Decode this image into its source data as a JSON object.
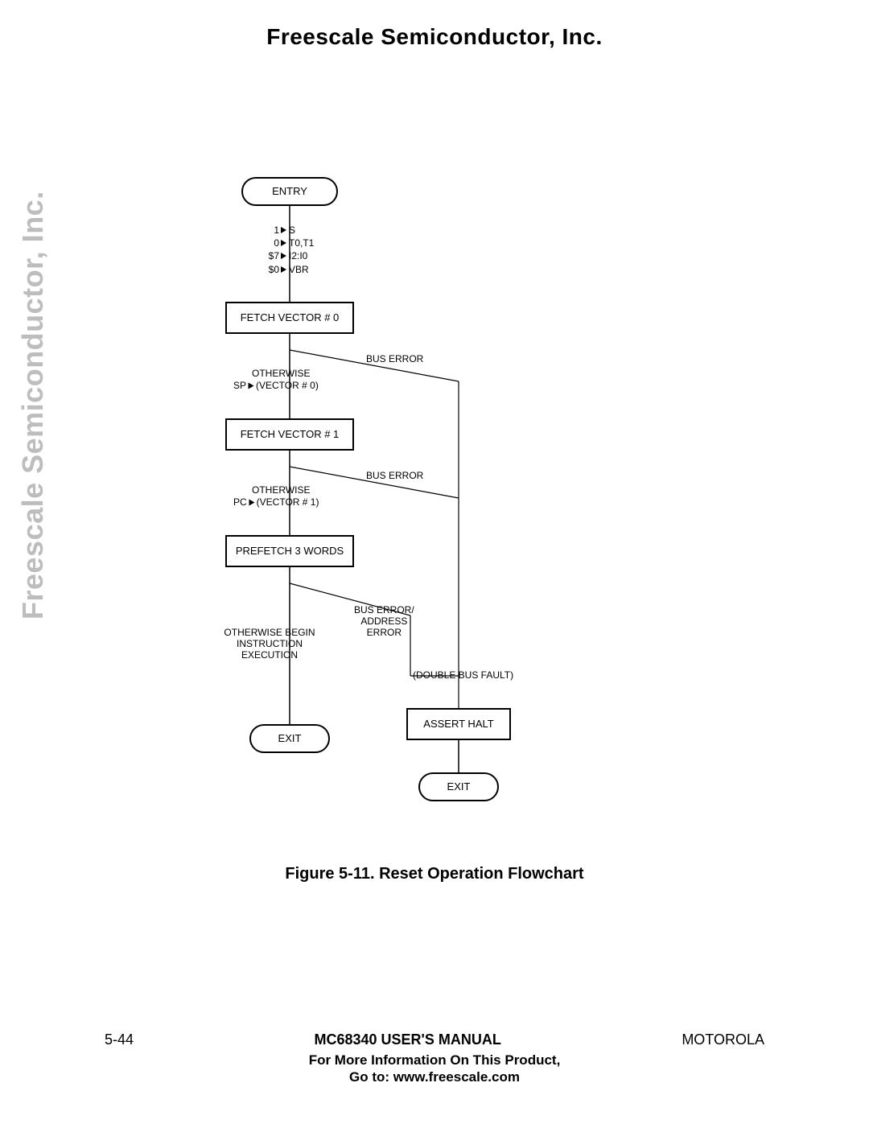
{
  "header": {
    "title": "Freescale Semiconductor, Inc."
  },
  "watermark": {
    "text": "Freescale Semiconductor, Inc."
  },
  "flow": {
    "entry": "ENTRY",
    "init": [
      {
        "l": "1",
        "r": "S"
      },
      {
        "l": "0",
        "r": "T0,T1"
      },
      {
        "l": "$7",
        "r": "I2:I0"
      },
      {
        "l": "$0",
        "r": "VBR"
      }
    ],
    "fetch0": "FETCH VECTOR # 0",
    "fetch1": "FETCH VECTOR # 1",
    "prefetch": "PREFETCH 3 WORDS",
    "assert_halt": "ASSERT HALT",
    "exit_left": "EXIT",
    "exit_right": "EXIT",
    "lbl_buserr": "BUS  ERROR",
    "lbl_otherwise": "OTHERWISE",
    "lbl_sp_vec0_l": "SP",
    "lbl_sp_vec0_r": "(VECTOR # 0)",
    "lbl_pc_vec1_l": "PC",
    "lbl_pc_vec1_r": "(VECTOR # 1)",
    "lbl_buserr_addr": "BUS ERROR/\nADDRESS\nERROR",
    "lbl_begin_exec": "OTHERWISE BEGIN\nINSTRUCTION\nEXECUTION",
    "lbl_dbl_fault": "(DOUBLE BUS FAULT)"
  },
  "caption": "Figure 5-11. Reset Operation Flowchart",
  "footer": {
    "page": "5-44",
    "manual": "MC68340 USER'S MANUAL",
    "brand": "MOTOROLA",
    "info1": "For More Information On This Product,",
    "info2": "Go to: www.freescale.com"
  }
}
